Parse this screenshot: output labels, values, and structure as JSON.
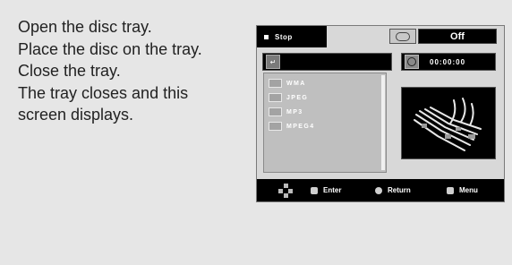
{
  "instructions": {
    "lines": [
      "Open the disc tray.",
      "Place the disc on the tray.",
      "Close the tray.",
      "The tray closes and this",
      "screen displays."
    ]
  },
  "screen": {
    "status_label": "Stop",
    "repeat_value": "Off",
    "time": "00:00:00",
    "file_types": [
      "WMA",
      "JPEG",
      "MP3",
      "MPEG4"
    ],
    "bottom": {
      "enter_label": "Enter",
      "return_label": "Return",
      "menu_label": "Menu"
    }
  },
  "icons": {
    "status": "stop-icon",
    "repeat": "repeat-icon",
    "folder_up": "folder-up-icon",
    "disc": "disc-icon",
    "nav": "navigation-arrows-icon",
    "enter": "enter-button-icon",
    "return": "return-button-icon",
    "menu": "menu-button-icon"
  },
  "colors": {
    "page_background": "#e6e6e6",
    "screen_background": "#d8d8d8",
    "bar_black": "#000000",
    "list_gray": "#bfbfbf"
  }
}
